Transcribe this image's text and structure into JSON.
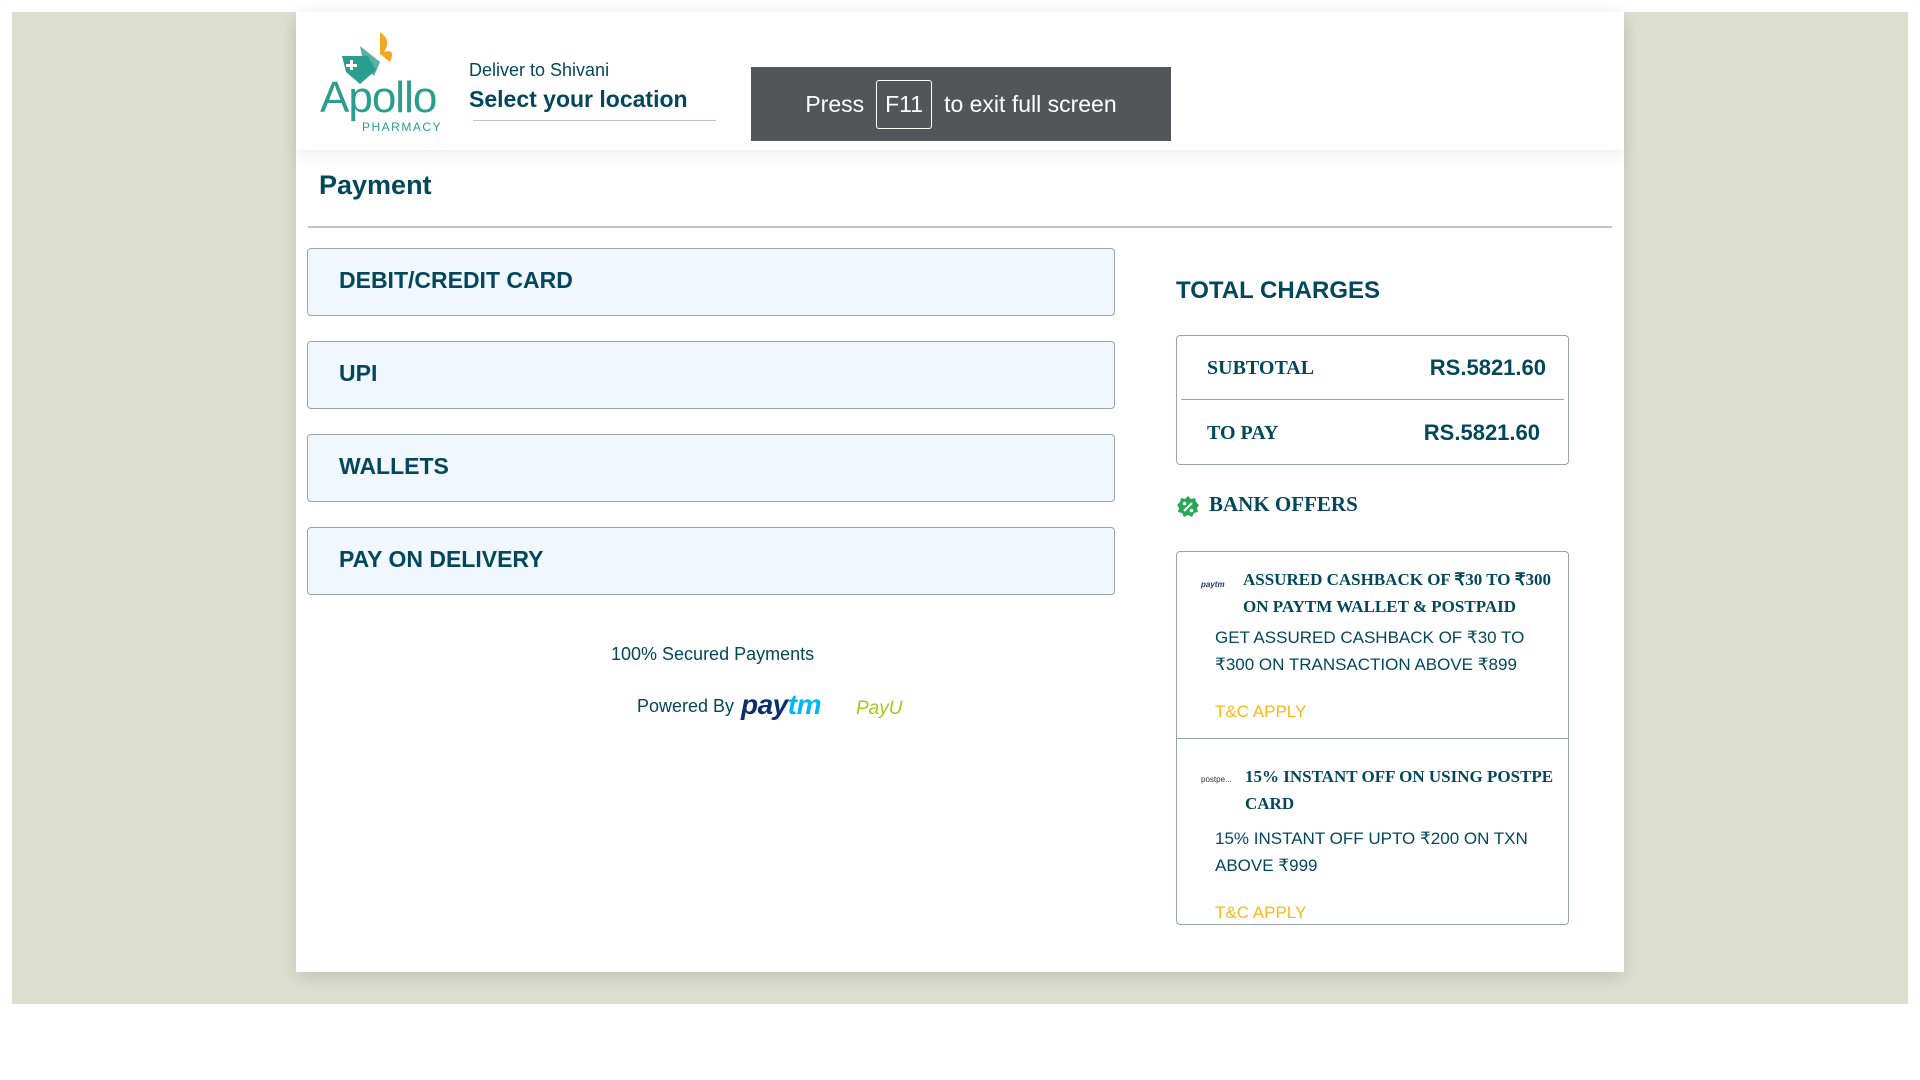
{
  "header": {
    "logo_text": "Apollo",
    "logo_subtext": "PHARMACY",
    "deliver_to": "Deliver to Shivani",
    "select_location": "Select your location"
  },
  "fullscreen_toast": {
    "prefix": "Press",
    "key": "F11",
    "suffix": "to exit full screen"
  },
  "payment": {
    "title": "Payment",
    "options": [
      {
        "label": "DEBIT/CREDIT CARD"
      },
      {
        "label": "UPI"
      },
      {
        "label": "WALLETS"
      },
      {
        "label": "PAY ON DELIVERY"
      }
    ],
    "secured_text": "100% Secured Payments",
    "powered_by": "Powered By",
    "paytm_logo": "paytm",
    "payu_logo": "PayU"
  },
  "charges": {
    "title": "TOTAL CHARGES",
    "subtotal_label": "SUBTOTAL",
    "subtotal_value": "RS.5821.60",
    "to_pay_label": "TO PAY",
    "to_pay_value": "RS.5821.60"
  },
  "bank_offers": {
    "title": "BANK OFFERS",
    "offers": [
      {
        "badge": "paytm",
        "title": "ASSURED CASHBACK OF ₹30 TO ₹300 ON PAYTM WALLET & POSTPAID",
        "description": "GET ASSURED CASHBACK OF ₹30 TO ₹300 ON TRANSACTION ABOVE ₹899",
        "tc": "T&C APPLY"
      },
      {
        "badge": "postpe...",
        "title": "15% INSTANT OFF ON USING POSTPE CARD",
        "description": "15% INSTANT OFF UPTO ₹200 ON TXN ABOVE ₹999",
        "tc": "T&C APPLY"
      }
    ]
  },
  "colors": {
    "primary_text": "#02475b",
    "option_background": "#f0f7fe",
    "tc_orange": "#fcb716",
    "backdrop": "#dddfcf",
    "offer_icon_green": "#2aa657"
  }
}
